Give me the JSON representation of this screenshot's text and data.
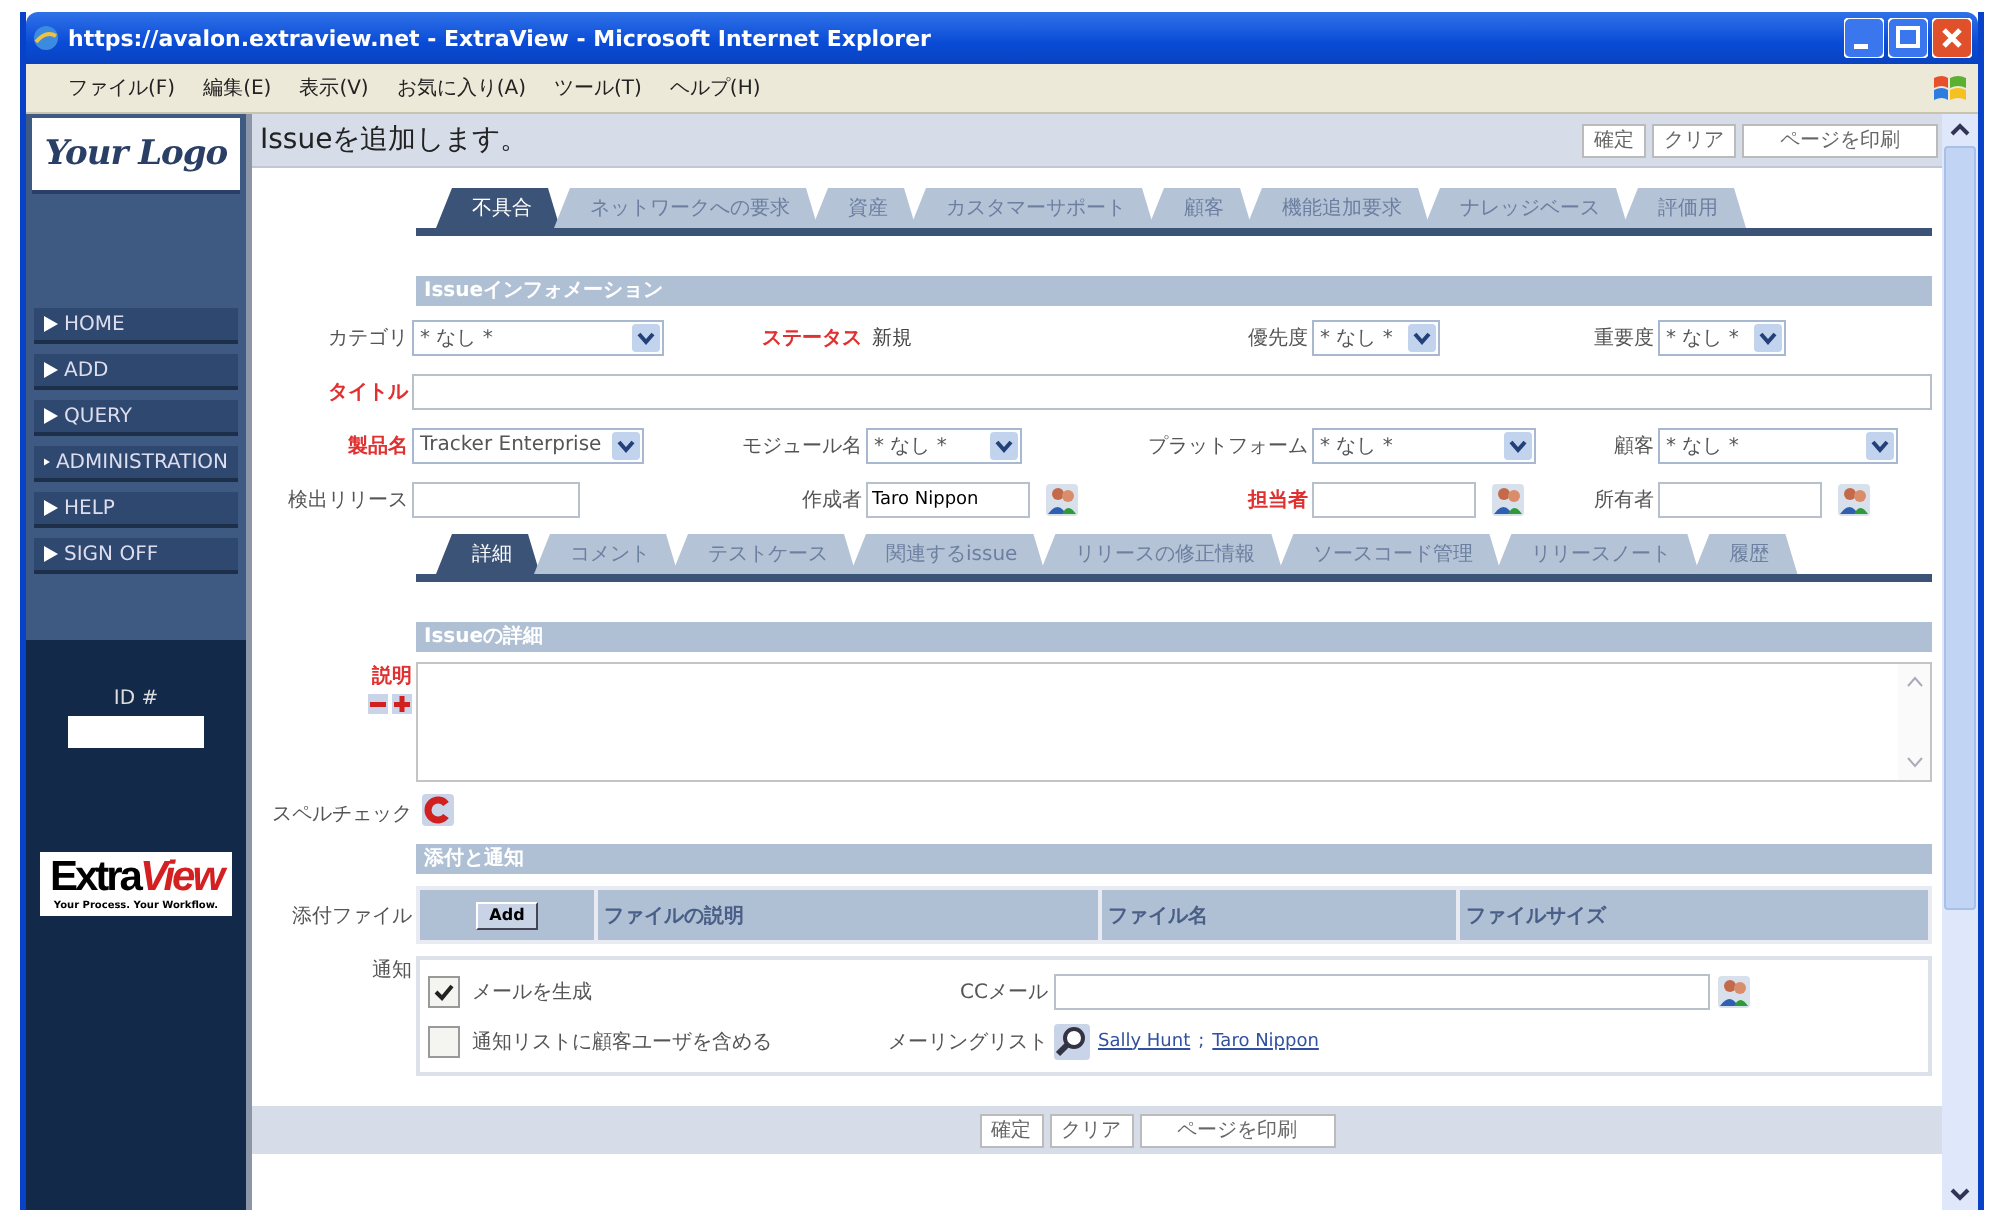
{
  "window": {
    "title": "https://avalon.extraview.net - ExtraView - Microsoft Internet Explorer"
  },
  "menu": [
    "ファイル(F)",
    "編集(E)",
    "表示(V)",
    "お気に入り(A)",
    "ツール(T)",
    "ヘルプ(H)"
  ],
  "sidebar": {
    "logo": "Your Logo",
    "nav": [
      "HOME",
      "ADD",
      "QUERY",
      "ADMINISTRATION",
      "HELP",
      "SIGN OFF"
    ],
    "id_label": "ID #",
    "brand": [
      "Extra",
      "View"
    ],
    "tagline": "Your Process. Your Workflow."
  },
  "header": {
    "title": "Issueを追加します。",
    "buttons": [
      "確定",
      "クリア",
      "ページを印刷"
    ]
  },
  "main_tabs": [
    {
      "label": "不具合",
      "selected": true
    },
    {
      "label": "ネットワークへの要求",
      "selected": false
    },
    {
      "label": "資産",
      "selected": false
    },
    {
      "label": "カスタマーサポート",
      "selected": false
    },
    {
      "label": "顧客",
      "selected": false
    },
    {
      "label": "機能追加要求",
      "selected": false
    },
    {
      "label": "ナレッジベース",
      "selected": false
    },
    {
      "label": "評価用",
      "selected": false
    }
  ],
  "info": {
    "heading": "Issueインフォメーション",
    "rows": [
      [
        {
          "label": "カテゴリ",
          "required": false,
          "kind": "select",
          "value": "* なし *"
        },
        {
          "label": "ステータス",
          "required": true,
          "kind": "static",
          "value": "新規"
        },
        {
          "label": "優先度",
          "required": false,
          "kind": "select",
          "value": "* なし *"
        },
        {
          "label": "重要度",
          "required": false,
          "kind": "select",
          "value": "* なし *"
        }
      ],
      [
        {
          "label": "タイトル",
          "required": true,
          "kind": "wide"
        }
      ],
      [
        {
          "label": "製品名",
          "required": true,
          "kind": "select",
          "value": "Tracker Enterprise"
        },
        {
          "label": "モジュール名",
          "required": false,
          "kind": "select",
          "value": "* なし *"
        },
        {
          "label": "プラットフォーム",
          "required": false,
          "kind": "select",
          "value": "* なし *"
        },
        {
          "label": "顧客",
          "required": false,
          "kind": "select",
          "value": "* なし *"
        }
      ],
      [
        {
          "label": "検出リリース",
          "required": false,
          "kind": "text"
        },
        {
          "label": "作成者",
          "required": false,
          "kind": "person",
          "value": "Taro Nippon"
        },
        {
          "label": "担当者",
          "required": true,
          "kind": "person"
        },
        {
          "label": "所有者",
          "required": false,
          "kind": "person"
        }
      ]
    ]
  },
  "detail_tabs": [
    {
      "label": "詳細",
      "selected": true
    },
    {
      "label": "コメント",
      "selected": false
    },
    {
      "label": "テストケース",
      "selected": false
    },
    {
      "label": "関連するissue",
      "selected": false
    },
    {
      "label": "リリースの修正情報",
      "selected": false
    },
    {
      "label": "ソースコード管理",
      "selected": false
    },
    {
      "label": "リリースノート",
      "selected": false
    },
    {
      "label": "履歴",
      "selected": false
    }
  ],
  "details": {
    "heading": "Issueの詳細",
    "label": "説明",
    "required": true
  },
  "spell_check": {
    "label": "スペルチェック"
  },
  "attachments": {
    "heading": "添付と通知",
    "label": "添付ファイル",
    "add_button": "Add",
    "columns": [
      "ファイルの説明",
      "ファイル名",
      "ファイルサイズ"
    ]
  },
  "notify": {
    "label": "通知",
    "options": [
      {
        "label": "メールを生成",
        "checked": true
      },
      {
        "label": "通知リストに顧客ユーザを含める",
        "checked": false
      }
    ],
    "cc_label": "CCメール",
    "mailing_label": "メーリングリスト",
    "mailing_list": [
      "Sally Hunt",
      "Taro Nippon"
    ],
    "separator": ";"
  },
  "footer": {
    "buttons": [
      "確定",
      "クリア",
      "ページを印刷"
    ]
  }
}
